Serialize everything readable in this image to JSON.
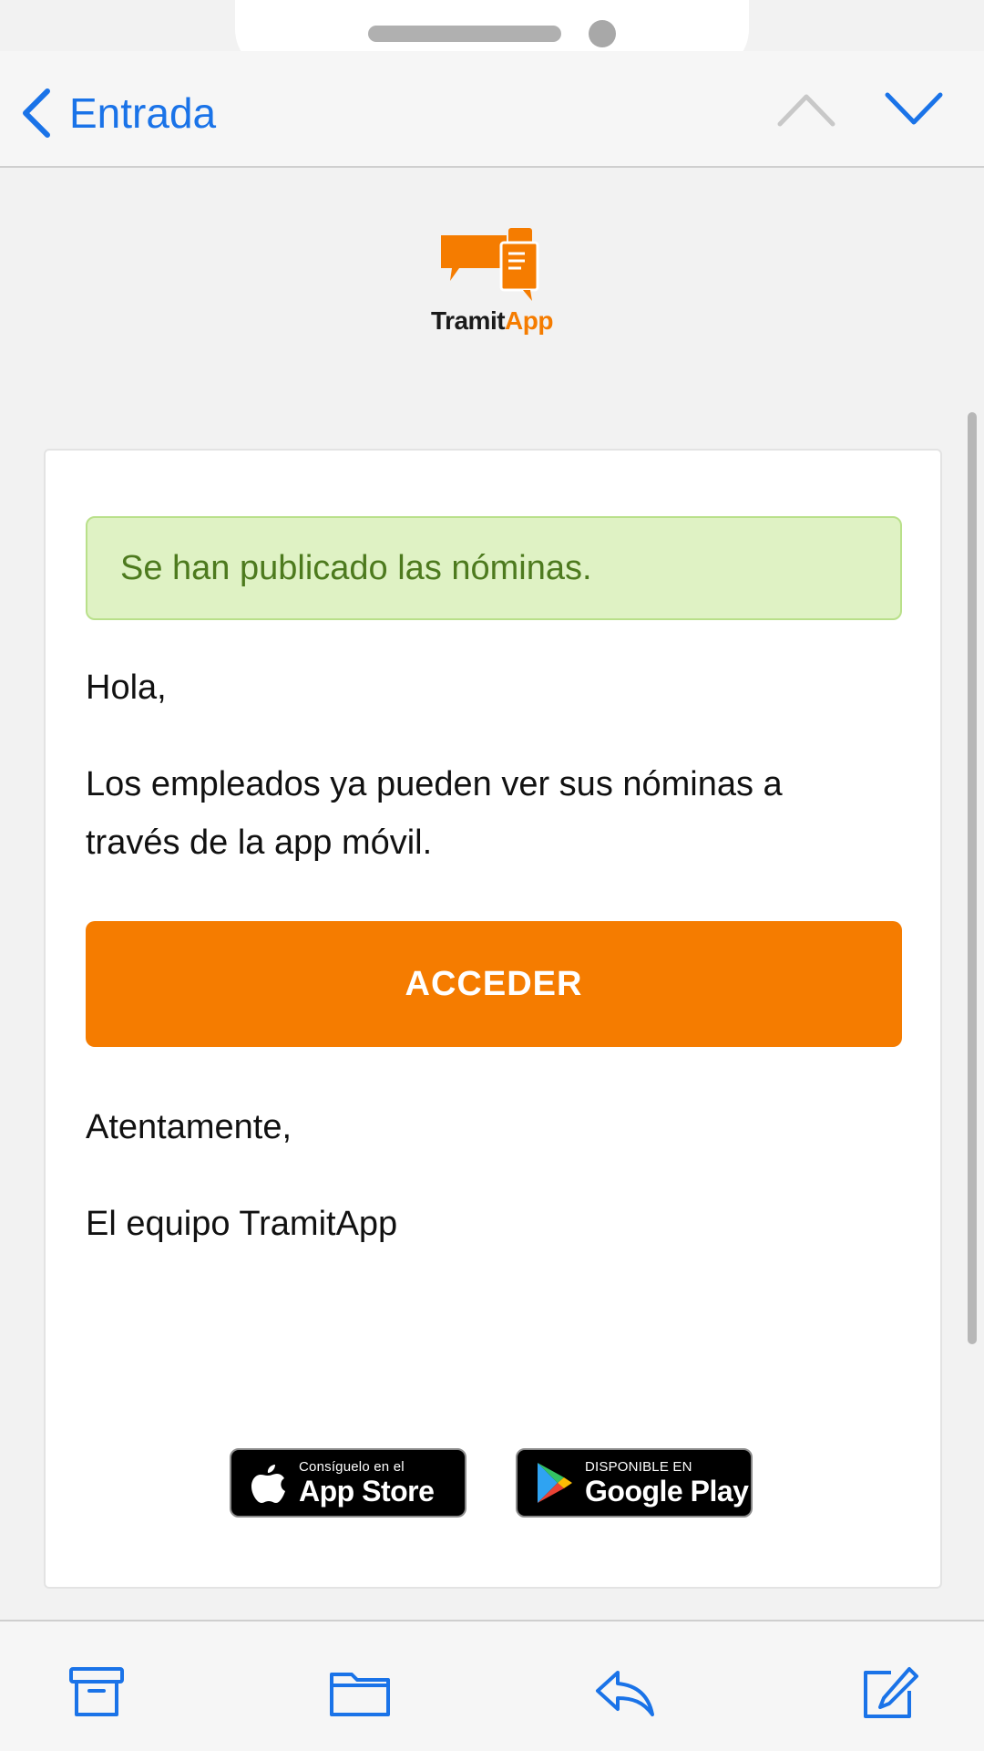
{
  "nav": {
    "back_label": "Entrada"
  },
  "logo": {
    "word_part1": "Tramit",
    "word_part2": "App"
  },
  "email": {
    "alert_text": "Se han publicado las nóminas.",
    "greeting": "Hola,",
    "body": "Los empleados ya pueden ver sus nóminas a través de la app móvil.",
    "cta_label": "ACCEDER",
    "signoff": "Atentamente,",
    "team": "El equipo TramitApp"
  },
  "badges": {
    "apple_small": "Consíguelo en el",
    "apple_big": "App Store",
    "google_small": "DISPONIBLE EN",
    "google_big": "Google Play"
  },
  "colors": {
    "accent_blue": "#1a73e8",
    "brand_orange": "#f57c00",
    "alert_bg": "#dff2c4",
    "alert_text": "#4d7a1e"
  },
  "icons": {
    "back": "chevron-left-icon",
    "prev": "chevron-up-icon",
    "next": "chevron-down-icon",
    "archive": "archive-icon",
    "folder": "folder-icon",
    "reply": "reply-icon",
    "compose": "compose-icon"
  }
}
